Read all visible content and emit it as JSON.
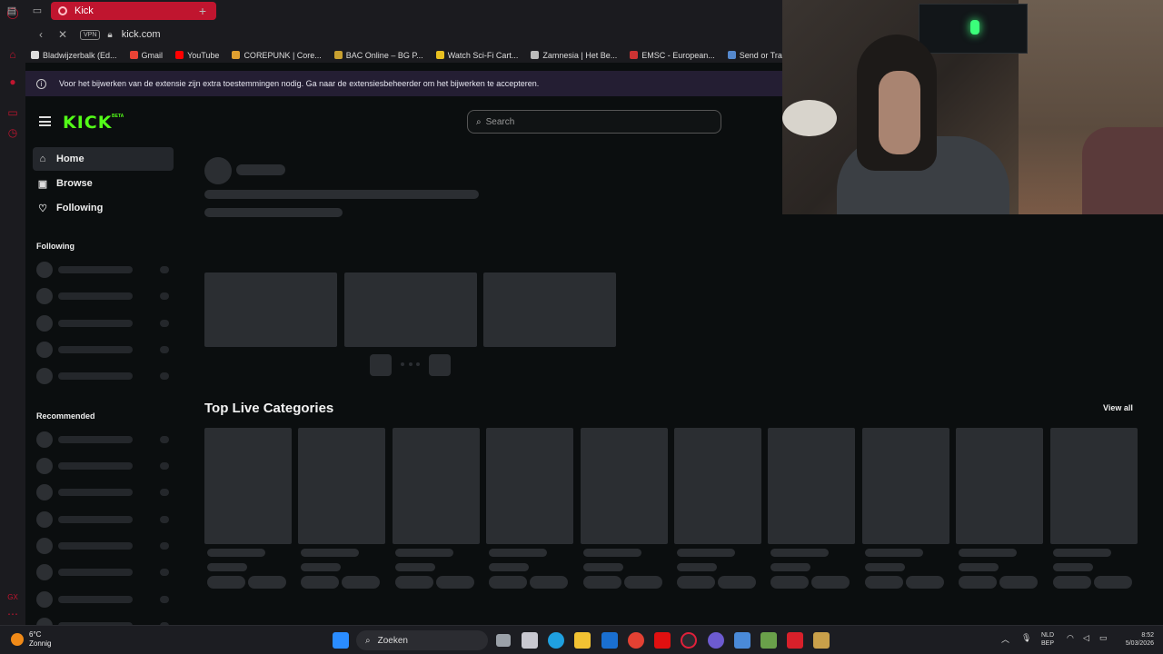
{
  "browser": {
    "tab_title": "Kick",
    "new_tab": "+",
    "url": "kick.com",
    "vpn": "VPN",
    "bookmarks": [
      {
        "label": "Bladwijzerbalk (Ed...",
        "color": "#ddd"
      },
      {
        "label": "Gmail",
        "color": "#ea4335"
      },
      {
        "label": "YouTube",
        "color": "#ff0000"
      },
      {
        "label": "COREPUNK | Core...",
        "color": "#e0a030"
      },
      {
        "label": "BAC Online – BG P...",
        "color": "#c8a030"
      },
      {
        "label": "Watch Sci-Fi Cart...",
        "color": "#e8c020"
      },
      {
        "label": "Zamnesia | Het Be...",
        "color": "#bbb"
      },
      {
        "label": "EMSC - European...",
        "color": "#cc3333"
      },
      {
        "label": "Send or Transfer...",
        "color": "#5588cc"
      }
    ],
    "notice": "Voor het bijwerken van de extensie zijn extra toestemmingen nodig. Ga naar de extensiesbeheerder om het bijwerken te accepteren."
  },
  "kick": {
    "logo": "KICK",
    "beta": "BETA",
    "search_placeholder": "Search",
    "nav": [
      {
        "label": "Home",
        "icon": "home-icon"
      },
      {
        "label": "Browse",
        "icon": "browse-icon"
      },
      {
        "label": "Following",
        "icon": "heart-icon"
      }
    ],
    "following_heading": "Following",
    "recommended_heading": "Recommended",
    "top_categories_title": "Top Live Categories",
    "view_all": "View all"
  },
  "taskbar": {
    "weather_temp": "6°C",
    "weather_desc": "Zonnig",
    "search_label": "Zoeken",
    "lang_line1": "NLD",
    "lang_line2": "BEP",
    "time": "8:52",
    "date": "5/03/2026"
  },
  "colors": {
    "kick_green": "#53fc18",
    "opera_red": "#c0152f",
    "background": "#0b0e0f"
  }
}
